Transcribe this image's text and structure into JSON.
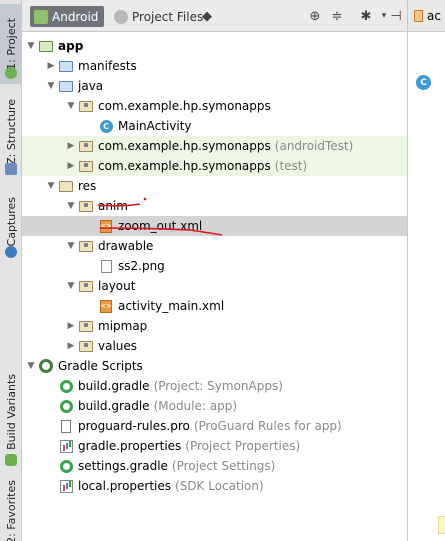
{
  "toolstrip": {
    "tabs": [
      {
        "label": "1: Project"
      },
      {
        "label": "Z: Structure"
      },
      {
        "label": "Captures"
      },
      {
        "label": "Build Variants"
      },
      {
        "label": "2: Favorites"
      }
    ]
  },
  "header": {
    "tabs": [
      {
        "label": "Android",
        "active": true
      },
      {
        "label": "Project Files",
        "active": false
      }
    ],
    "buttons": [
      "target-icon",
      "collapse-icon",
      "gear-icon",
      "hide-icon"
    ]
  },
  "editor": {
    "tab_label": "ac",
    "gutter_icon": "C"
  },
  "tree": {
    "rows": [
      {
        "label": "app",
        "hint": "",
        "indent": 0,
        "arrow": "open",
        "icon": "folder-app",
        "bold": true
      },
      {
        "label": "manifests",
        "hint": "",
        "indent": 1,
        "arrow": "closed",
        "icon": "folder-blue"
      },
      {
        "label": "java",
        "hint": "",
        "indent": 1,
        "arrow": "open",
        "icon": "folder-blue"
      },
      {
        "label": "com.example.hp.symonapps",
        "hint": "",
        "indent": 2,
        "arrow": "open",
        "icon": "folder-pkg"
      },
      {
        "label": "MainActivity",
        "hint": "",
        "indent": 3,
        "arrow": "none",
        "icon": "class"
      },
      {
        "label": "com.example.hp.symonapps",
        "hint": "(androidTest)",
        "indent": 2,
        "arrow": "closed",
        "icon": "folder-pkg",
        "green": true
      },
      {
        "label": "com.example.hp.symonapps",
        "hint": "(test)",
        "indent": 2,
        "arrow": "closed",
        "icon": "folder-pkg",
        "green": true
      },
      {
        "label": "res",
        "hint": "",
        "indent": 1,
        "arrow": "open",
        "icon": "folder-res"
      },
      {
        "label": "anim",
        "hint": "",
        "indent": 2,
        "arrow": "open",
        "icon": "folder-pkg"
      },
      {
        "label": "zoom_out.xml",
        "hint": "",
        "indent": 3,
        "arrow": "none",
        "icon": "xml",
        "selected": true
      },
      {
        "label": "drawable",
        "hint": "",
        "indent": 2,
        "arrow": "open",
        "icon": "folder-pkg"
      },
      {
        "label": "ss2.png",
        "hint": "",
        "indent": 3,
        "arrow": "none",
        "icon": "png"
      },
      {
        "label": "layout",
        "hint": "",
        "indent": 2,
        "arrow": "open",
        "icon": "folder-pkg"
      },
      {
        "label": "activity_main.xml",
        "hint": "",
        "indent": 3,
        "arrow": "none",
        "icon": "xml"
      },
      {
        "label": "mipmap",
        "hint": "",
        "indent": 2,
        "arrow": "closed",
        "icon": "folder-pkg"
      },
      {
        "label": "values",
        "hint": "",
        "indent": 2,
        "arrow": "closed",
        "icon": "folder-pkg"
      },
      {
        "label": "Gradle Scripts",
        "hint": "",
        "indent": 0,
        "arrow": "open",
        "icon": "gradle-root"
      },
      {
        "label": "build.gradle",
        "hint": "(Project: SymonApps)",
        "indent": 1,
        "arrow": "none",
        "icon": "gradle"
      },
      {
        "label": "build.gradle",
        "hint": "(Module: app)",
        "indent": 1,
        "arrow": "none",
        "icon": "gradle"
      },
      {
        "label": "proguard-rules.pro",
        "hint": "(ProGuard Rules for app)",
        "indent": 1,
        "arrow": "none",
        "icon": "file"
      },
      {
        "label": "gradle.properties",
        "hint": "(Project Properties)",
        "indent": 1,
        "arrow": "none",
        "icon": "props"
      },
      {
        "label": "settings.gradle",
        "hint": "(Project Settings)",
        "indent": 1,
        "arrow": "none",
        "icon": "gradle"
      },
      {
        "label": "local.properties",
        "hint": "(SDK Location)",
        "indent": 1,
        "arrow": "none",
        "icon": "props"
      }
    ]
  }
}
